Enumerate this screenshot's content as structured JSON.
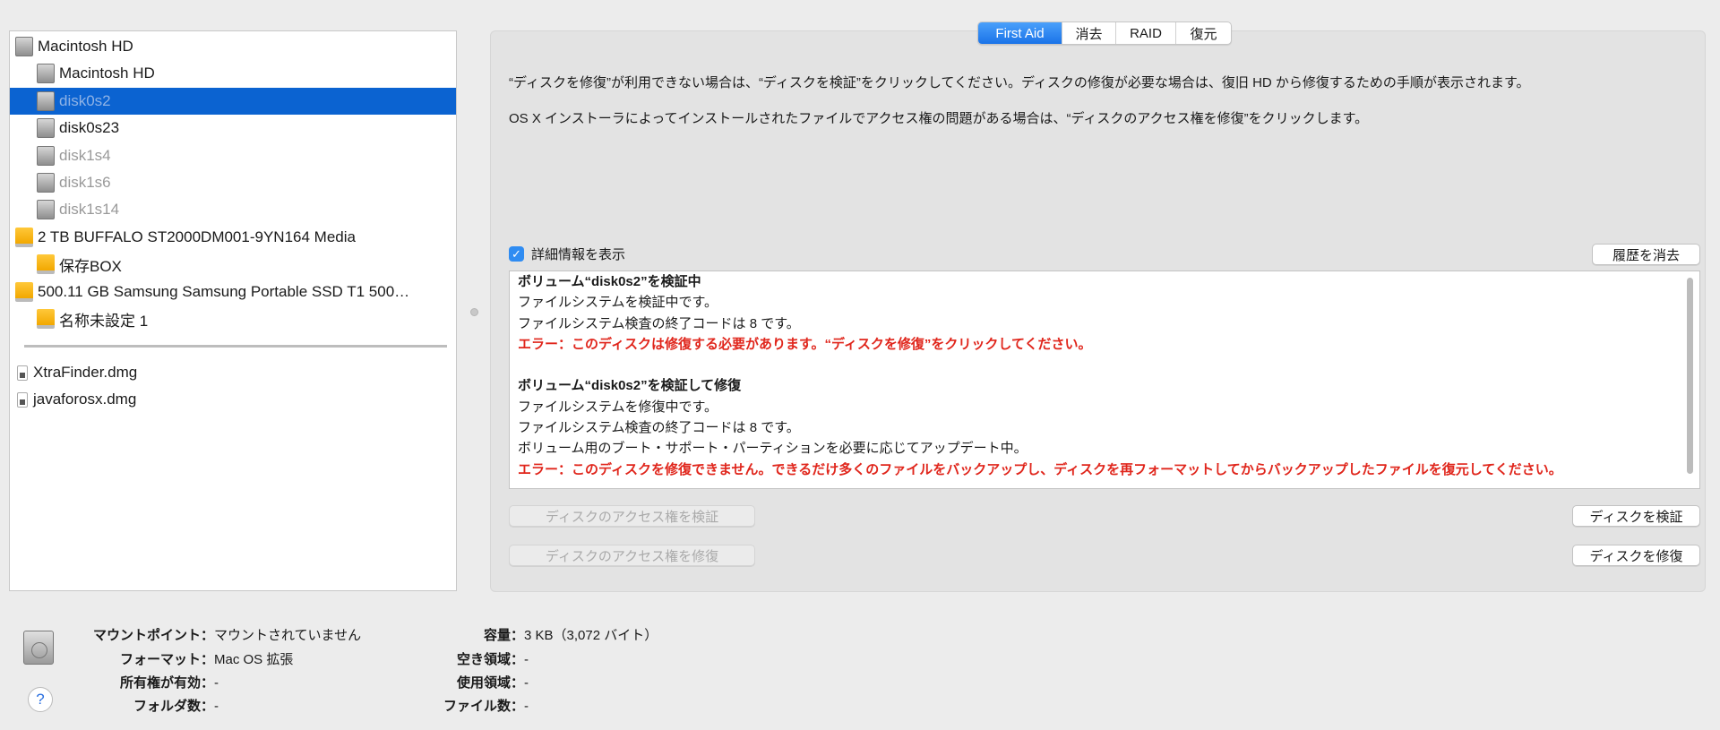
{
  "sidebar": {
    "items": [
      {
        "label": "Macintosh HD",
        "level": 0,
        "icon": "gray",
        "state": "normal"
      },
      {
        "label": "Macintosh HD",
        "level": 1,
        "icon": "gray",
        "state": "normal"
      },
      {
        "label": "disk0s2",
        "level": 1,
        "icon": "gray",
        "state": "selected"
      },
      {
        "label": "disk0s23",
        "level": 1,
        "icon": "gray",
        "state": "normal"
      },
      {
        "label": "disk1s4",
        "level": 1,
        "icon": "gray",
        "state": "dim"
      },
      {
        "label": "disk1s6",
        "level": 1,
        "icon": "gray",
        "state": "dim"
      },
      {
        "label": "disk1s14",
        "level": 1,
        "icon": "gray",
        "state": "dim"
      },
      {
        "label": "2 TB BUFFALO ST2000DM001-9YN164 Media",
        "level": 0,
        "icon": "orange",
        "state": "normal"
      },
      {
        "label": "保存BOX",
        "level": 1,
        "icon": "orange",
        "state": "normal"
      },
      {
        "label": "500.11 GB Samsung Samsung Portable SSD T1 500…",
        "level": 0,
        "icon": "orange",
        "state": "normal"
      },
      {
        "label": "名称未設定 1",
        "level": 1,
        "icon": "orange",
        "state": "normal"
      }
    ],
    "images": [
      {
        "label": "XtraFinder.dmg"
      },
      {
        "label": "javaforosx.dmg"
      }
    ]
  },
  "tabs": [
    "First Aid",
    "消去",
    "RAID",
    "復元"
  ],
  "first_aid": {
    "desc1": "“ディスクを修復”が利用できない場合は、“ディスクを検証”をクリックしてください。ディスクの修復が必要な場合は、復旧 HD から修復するための手順が表示されます。",
    "desc2": "OS X インストーラによってインストールされたファイルでアクセス権の問題がある場合は、“ディスクのアクセス権を修復”をクリックします。",
    "show_details_label": "詳細情報を表示",
    "show_details_checked": true,
    "clear_history": "履歴を消去",
    "log": [
      {
        "text": "ボリューム“disk0s2”を検証中",
        "style": "bold"
      },
      {
        "text": "ファイルシステムを検証中です。",
        "style": "normal"
      },
      {
        "text": "ファイルシステム検査の終了コードは 8 です。",
        "style": "normal"
      },
      {
        "text": "エラー：このディスクは修復する必要があります。“ディスクを修復”をクリックしてください。",
        "style": "err"
      },
      {
        "text": "",
        "style": "normal"
      },
      {
        "text": "ボリューム“disk0s2”を検証して修復",
        "style": "bold"
      },
      {
        "text": "ファイルシステムを修復中です。",
        "style": "normal"
      },
      {
        "text": "ファイルシステム検査の終了コードは 8 です。",
        "style": "normal"
      },
      {
        "text": "ボリューム用のブート・サポート・パーティションを必要に応じてアップデート中。",
        "style": "normal"
      },
      {
        "text": "エラー：このディスクを修復できません。できるだけ多くのファイルをバックアップし、ディスクを再フォーマットしてからバックアップしたファイルを復元してください。",
        "style": "err"
      }
    ],
    "verify_permissions": "ディスクのアクセス権を検証",
    "repair_permissions": "ディスクのアクセス権を修復",
    "verify_disk": "ディスクを検証",
    "repair_disk": "ディスクを修復"
  },
  "info": {
    "left": [
      {
        "k": "マウントポイント：",
        "v": "マウントされていません"
      },
      {
        "k": "フォーマット：",
        "v": "Mac OS 拡張"
      },
      {
        "k": "所有権が有効：",
        "v": "-"
      },
      {
        "k": "フォルダ数：",
        "v": "-"
      }
    ],
    "right": [
      {
        "k": "容量：",
        "v": "3 KB（3,072 バイト）"
      },
      {
        "k": "空き領域：",
        "v": "-"
      },
      {
        "k": "使用領域：",
        "v": "-"
      },
      {
        "k": "ファイル数：",
        "v": "-"
      }
    ],
    "help": "?"
  },
  "colors": {
    "accent": "#0b63d1",
    "error": "#e0261c"
  }
}
